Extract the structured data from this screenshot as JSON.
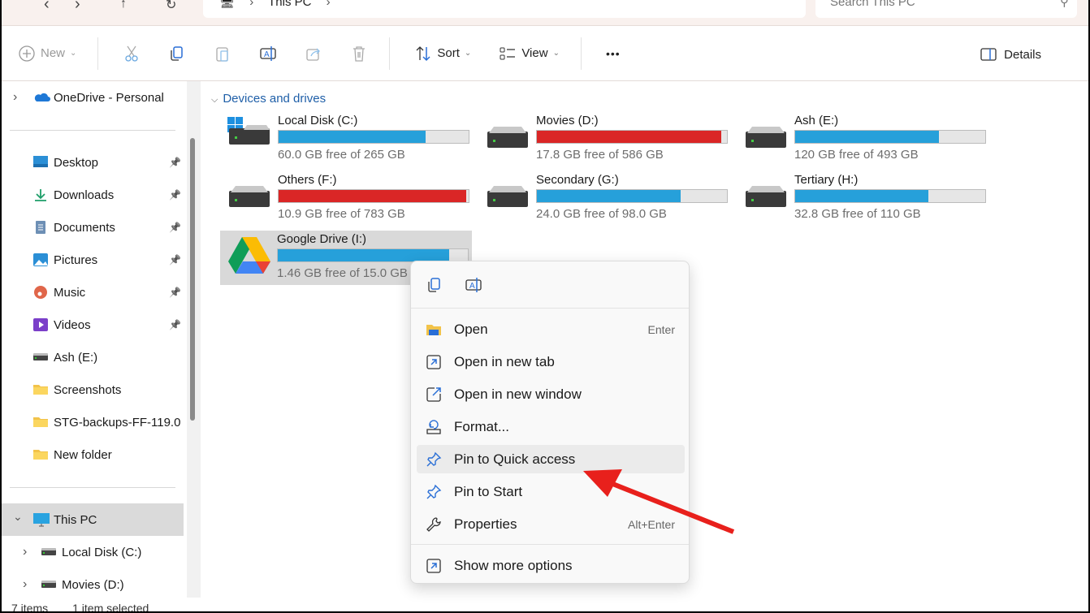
{
  "breadcrumb": {
    "location": "This PC"
  },
  "search": {
    "placeholder": "Search This PC"
  },
  "toolbar": {
    "new": "New",
    "sort": "Sort",
    "view": "View",
    "more": "•••",
    "details": "Details"
  },
  "sidebar": {
    "items": [
      {
        "label": "OneDrive - Personal",
        "icon": "onedrive-icon"
      },
      {
        "label": "Desktop",
        "icon": "desktop-icon",
        "pinned": true
      },
      {
        "label": "Downloads",
        "icon": "download-icon",
        "pinned": true
      },
      {
        "label": "Documents",
        "icon": "documents-icon",
        "pinned": true
      },
      {
        "label": "Pictures",
        "icon": "pictures-icon",
        "pinned": true
      },
      {
        "label": "Music",
        "icon": "music-icon",
        "pinned": true
      },
      {
        "label": "Videos",
        "icon": "videos-icon",
        "pinned": true
      },
      {
        "label": "Ash (E:)",
        "icon": "drive-icon"
      },
      {
        "label": "Screenshots",
        "icon": "folder-icon"
      },
      {
        "label": "STG-backups-FF-119.0",
        "icon": "folder-icon"
      },
      {
        "label": "New folder",
        "icon": "folder-icon"
      },
      {
        "label": "This PC",
        "icon": "computer-icon",
        "selected": true
      },
      {
        "label": "Local Disk (C:)",
        "icon": "drive-icon"
      },
      {
        "label": "Movies (D:)",
        "icon": "drive-icon"
      }
    ]
  },
  "content": {
    "group": "Devices and drives",
    "drives": [
      {
        "name": "Local Disk (C:)",
        "free": "60.0 GB free of 265 GB",
        "used_pct": 77.4,
        "color": "#26a0da",
        "type": "windows"
      },
      {
        "name": "Movies (D:)",
        "free": "17.8 GB free of 586 GB",
        "used_pct": 97,
        "color": "#da2626",
        "type": "hdd"
      },
      {
        "name": "Ash (E:)",
        "free": "120 GB free of 493 GB",
        "used_pct": 75.7,
        "color": "#26a0da",
        "type": "hdd"
      },
      {
        "name": "Others (F:)",
        "free": "10.9 GB free of 783 GB",
        "used_pct": 98.6,
        "color": "#da2626",
        "type": "hdd"
      },
      {
        "name": "Secondary (G:)",
        "free": "24.0 GB free of 98.0 GB",
        "used_pct": 75.5,
        "color": "#26a0da",
        "type": "hdd"
      },
      {
        "name": "Tertiary (H:)",
        "free": "32.8 GB free of 110 GB",
        "used_pct": 70.2,
        "color": "#26a0da",
        "type": "hdd"
      },
      {
        "name": "Google Drive (I:)",
        "free": "1.46 GB free of 15.0 GB",
        "used_pct": 90.3,
        "color": "#26a0da",
        "type": "gdrive",
        "selected": true
      }
    ]
  },
  "status": {
    "count": "7 items",
    "selected": "1 item selected"
  },
  "context_menu": {
    "items": [
      {
        "label": "Open",
        "shortcut": "Enter",
        "icon": "folder-open-icon"
      },
      {
        "label": "Open in new tab",
        "shortcut": "",
        "icon": "new-tab-icon"
      },
      {
        "label": "Open in new window",
        "shortcut": "",
        "icon": "new-window-icon"
      },
      {
        "label": "Format...",
        "shortcut": "",
        "icon": "format-icon"
      },
      {
        "label": "Pin to Quick access",
        "shortcut": "",
        "icon": "pin-icon",
        "highlighted": true
      },
      {
        "label": "Pin to Start",
        "shortcut": "",
        "icon": "pin-icon"
      },
      {
        "label": "Properties",
        "shortcut": "Alt+Enter",
        "icon": "wrench-icon"
      },
      {
        "label": "Show more options",
        "shortcut": "",
        "icon": "more-options-icon"
      }
    ]
  },
  "annotation": {
    "arrow_color": "#e8201c"
  }
}
